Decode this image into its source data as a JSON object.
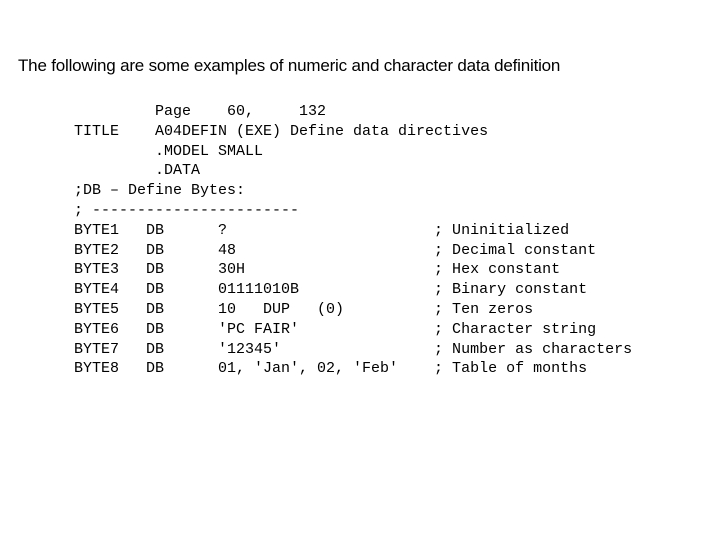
{
  "heading": "The following are some examples of numeric and character data definition",
  "code": {
    "l01": "         Page    60,     132",
    "l02": "TITLE    A04DEFIN (EXE) Define data directives",
    "l03": "         .MODEL SMALL",
    "l04": "         .DATA",
    "l05": ";DB – Define Bytes:",
    "l06": "; -----------------------",
    "l07": "BYTE1   DB      ?                       ; Uninitialized",
    "l08": "BYTE2   DB      48                      ; Decimal constant",
    "l09": "BYTE3   DB      30H                     ; Hex constant",
    "l10": "BYTE4   DB      01111010B               ; Binary constant",
    "l11": "BYTE5   DB      10   DUP   (0)          ; Ten zeros",
    "l12": "BYTE6   DB      'PC FAIR'               ; Character string",
    "l13": "BYTE7   DB      '12345'                 ; Number as characters",
    "l14": "BYTE8   DB      01, 'Jan', 02, 'Feb'    ; Table of months"
  }
}
